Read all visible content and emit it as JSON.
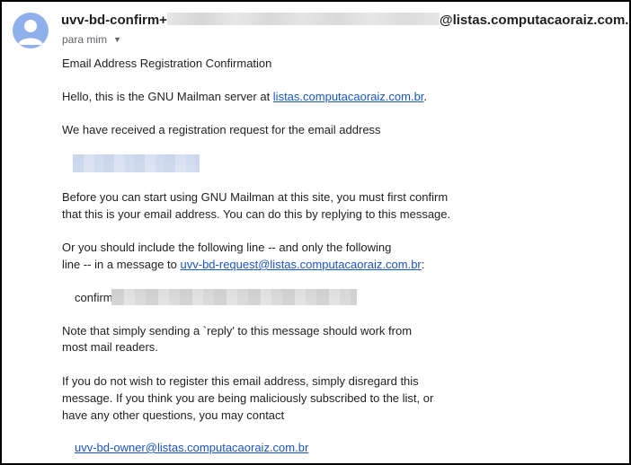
{
  "header": {
    "sender_prefix": "uvv-bd-confirm+",
    "sender_suffix": "@listas.computacaoraiz.com.br",
    "recipient": "para mim",
    "icons": {
      "avatar": "person-avatar-icon",
      "dropdown": "chevron-down-icon"
    },
    "avatar_color": "#8fb0ea"
  },
  "email": {
    "title": "Email Address Registration Confirmation",
    "hello_text": "Hello, this is the GNU Mailman server at ",
    "server_link": "listas.computacaoraiz.com.br",
    "hello_end": ".",
    "received": "We have received a registration request for the email address",
    "before_1": "Before you can start using GNU Mailman at this site, you must first confirm",
    "before_2": "that this is your email address.  You can do this by replying to this message.",
    "or_1": "Or you should include the following line -- and only the following",
    "or_2_prefix": "line -- in a message to ",
    "request_link": "uvv-bd-request@listas.computacaoraiz.com.br",
    "or_2_suffix": ":",
    "confirm_word": "confirm",
    "note_1": "Note that simply sending a `reply' to this message should work from",
    "note_2": "most mail readers.",
    "ifnot_1": "If you do not wish to register this email address, simply disregard this",
    "ifnot_2": "message.  If you think you are being maliciously subscribed to the list, or",
    "ifnot_3": "have any other questions, you may contact",
    "owner_link": "uvv-bd-owner@listas.computacaoraiz.com.br",
    "link_color": "#1a55c4"
  }
}
